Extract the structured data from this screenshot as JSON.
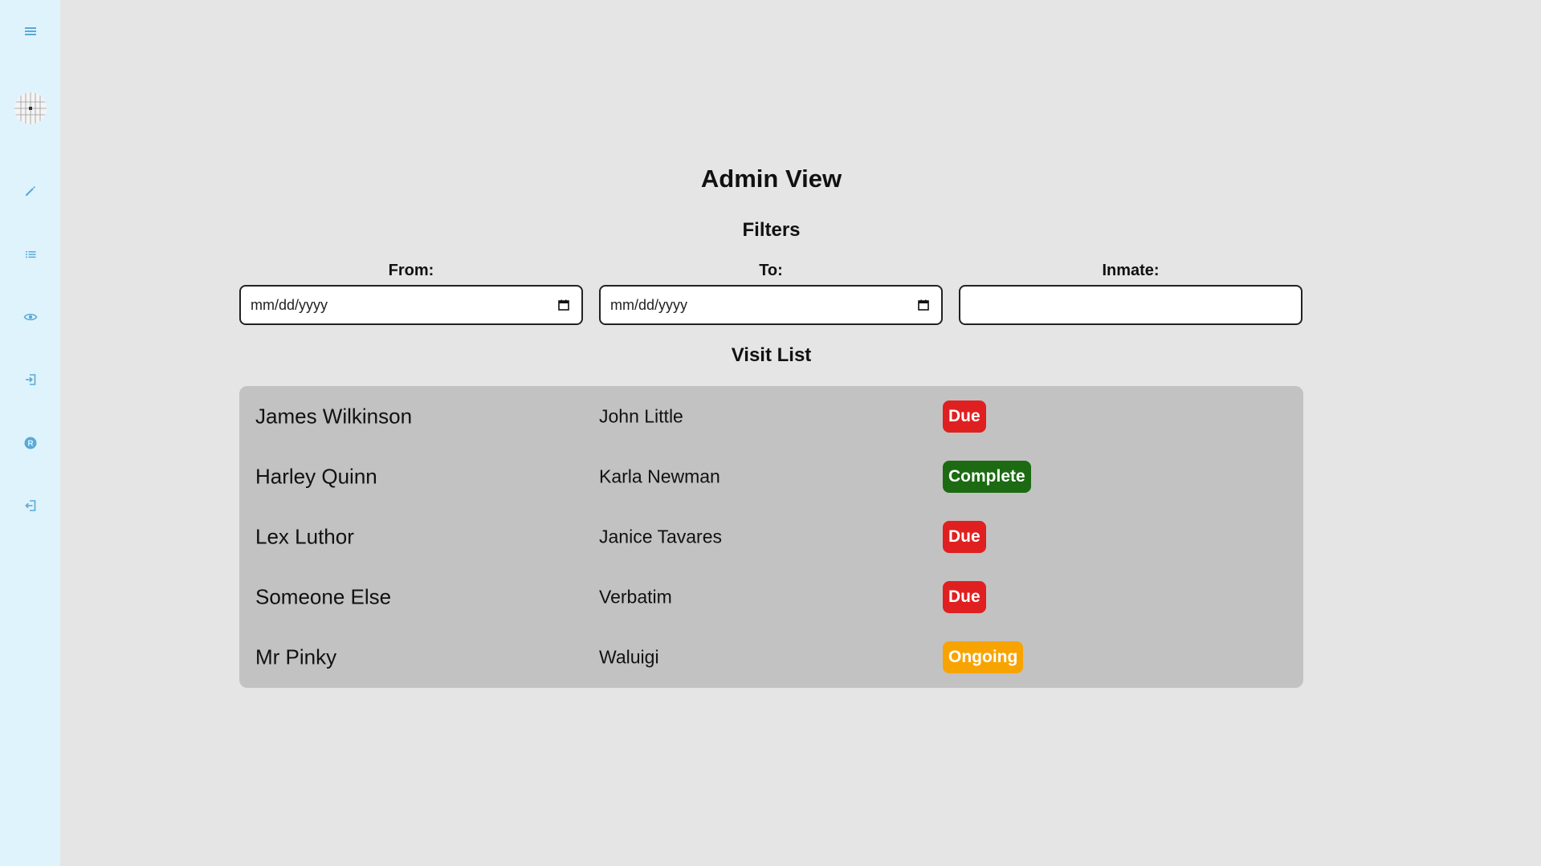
{
  "sidebar": {
    "items": [
      {
        "icon": "menu-icon"
      },
      {
        "icon": "pencil-icon"
      },
      {
        "icon": "list-icon"
      },
      {
        "icon": "eye-icon"
      },
      {
        "icon": "sign-in-icon"
      },
      {
        "icon": "registered-icon"
      },
      {
        "icon": "sign-out-icon"
      }
    ],
    "icon_color": "#5aa9d6",
    "background": "#dff3fd"
  },
  "page": {
    "title": "Admin View",
    "filters_title": "Filters",
    "visit_list_title": "Visit List"
  },
  "filters": {
    "from_label": "From:",
    "from_placeholder": "mm/dd/yyyy",
    "to_label": "To:",
    "to_placeholder": "mm/dd/yyyy",
    "inmate_label": "Inmate:",
    "inmate_value": ""
  },
  "visits": [
    {
      "inmate": "James Wilkinson",
      "visitor": "John Little",
      "status": "Due",
      "status_color": "#e02020"
    },
    {
      "inmate": "Harley Quinn",
      "visitor": "Karla Newman",
      "status": "Complete",
      "status_color": "#1c6b12"
    },
    {
      "inmate": "Lex Luthor",
      "visitor": "Janice Tavares",
      "status": "Due",
      "status_color": "#e02020"
    },
    {
      "inmate": "Someone Else",
      "visitor": "Verbatim",
      "status": "Due",
      "status_color": "#e02020"
    },
    {
      "inmate": "Mr Pinky",
      "visitor": "Waluigi",
      "status": "Ongoing",
      "status_color": "#f7a400"
    }
  ],
  "colors": {
    "page_background": "#e5e5e5",
    "list_background": "#c2c2c2"
  }
}
